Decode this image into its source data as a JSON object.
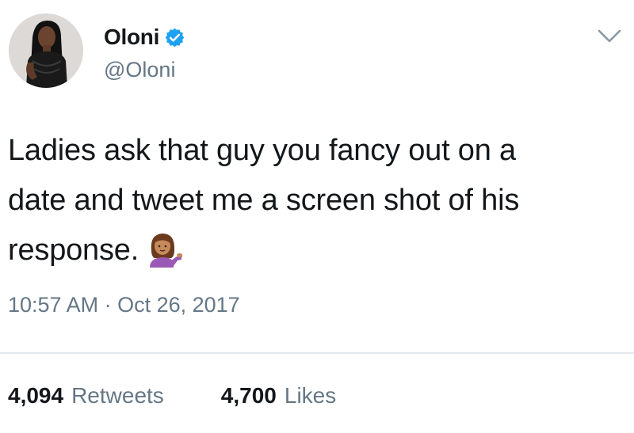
{
  "author": {
    "display_name": "Oloni",
    "handle": "@Oloni",
    "verified": true,
    "avatar_icon": "profile-photo"
  },
  "menu": {
    "icon": "chevron-down-icon"
  },
  "tweet": {
    "lines": [
      "Ladies ask that guy you fancy out on a",
      "date and tweet me a screen shot of his",
      "response."
    ],
    "emoji": "person-tipping-hand-emoji",
    "timestamp": "10:57 AM · Oct 26, 2017"
  },
  "stats": {
    "retweets_count": "4,094",
    "retweets_label": "Retweets",
    "likes_count": "4,700",
    "likes_label": "Likes"
  },
  "colors": {
    "text": "#14171a",
    "secondary": "#657786",
    "verified": "#1da1f2",
    "divider": "#e1e8ed"
  }
}
